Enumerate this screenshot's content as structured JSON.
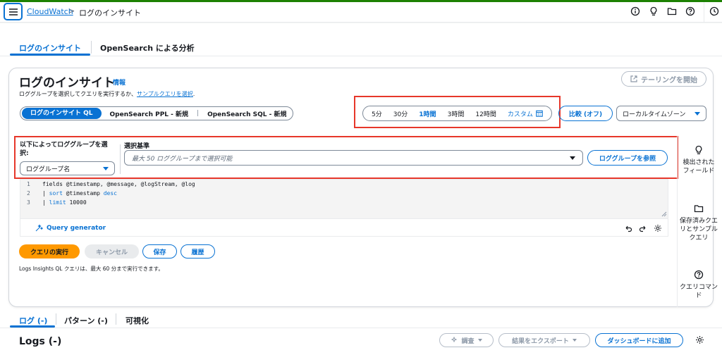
{
  "colors": {
    "accent": "#0972d3",
    "run": "#ff9900",
    "highlight": "#e7372a"
  },
  "breadcrumb": {
    "root": "CloudWatch",
    "separator": ">",
    "current": "ログのインサイト"
  },
  "topbar_icons": [
    "info-circle-icon",
    "lightbulb-icon",
    "folder-icon",
    "help-icon",
    "status-icon"
  ],
  "page_tabs": [
    {
      "label": "ログのインサイト",
      "active": true
    },
    {
      "label": "OpenSearch による分析",
      "active": false
    }
  ],
  "header": {
    "title": "ログのインサイト",
    "info": "情報",
    "desc_prefix": "ロググループを選択してクエリを実行するか、",
    "desc_link": "サンプルクエリを選択",
    "desc_suffix": ".",
    "tail_button": "テーリングを開始"
  },
  "query_languages": [
    {
      "label": "ログのインサイト QL",
      "active": true
    },
    {
      "label": "OpenSearch PPL - 新規",
      "active": false
    },
    {
      "label": "OpenSearch SQL - 新規",
      "active": false
    }
  ],
  "time_range": {
    "options": [
      "5分",
      "30分",
      "1時間",
      "3時間",
      "12時間"
    ],
    "selected": "1時間",
    "custom": "カスタム"
  },
  "compare_button": "比較 (オフ)",
  "timezone": "ローカルタイムゾーン",
  "log_group": {
    "select_by_label": "以下によってロググループを選択:",
    "select_by_value": "ロググループ名",
    "criteria_label": "選択基準",
    "criteria_placeholder": "最大 50 ロググループまで選択可能",
    "browse_button": "ロググループを参照"
  },
  "editor": {
    "line_numbers": [
      "1",
      "2",
      "3"
    ],
    "lines": {
      "l1": "fields @timestamp, @message, @logStream, @log",
      "l2_pipe": "| ",
      "l2_cmd": "sort",
      "l2_rest": " @timestamp ",
      "l2_kw": "desc",
      "l3_pipe": "| ",
      "l3_cmd": "limit",
      "l3_rest": " 10000"
    },
    "query_generator": "Query generator"
  },
  "side_panel": [
    {
      "icon": "lightbulb-icon",
      "label": "検出されたフィールド"
    },
    {
      "icon": "folder-icon",
      "label": "保存済みクエリとサンプルクエリ"
    },
    {
      "icon": "help-icon",
      "label": "クエリコマンド"
    }
  ],
  "actions": {
    "run": "クエリの実行",
    "cancel": "キャンセル",
    "save": "保存",
    "history": "履歴",
    "note": "Logs Insights QL クエリは、最大 60 分まで実行できます。"
  },
  "result_tabs": [
    {
      "label": "ログ (-)",
      "active": true
    },
    {
      "label": "パターン (-)",
      "active": false
    },
    {
      "label": "可視化",
      "active": false
    }
  ],
  "results": {
    "title": "Logs (-)",
    "investigate": "調査",
    "export": "結果をエクスポート",
    "dashboard": "ダッシュボードに追加"
  }
}
